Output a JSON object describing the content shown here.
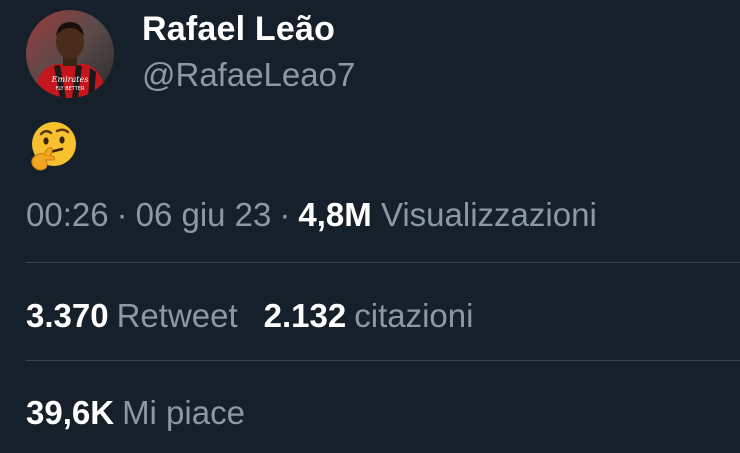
{
  "author": {
    "display_name": "Rafael Leão",
    "handle": "@RafaeLeao7",
    "avatar_icon": "profile-photo",
    "avatar_jersey_text_1": "Emirates",
    "avatar_jersey_text_2": "FLY BETTER"
  },
  "tweet": {
    "emoji": "thinking-face-emoji"
  },
  "meta": {
    "time": "00:26",
    "separator": "·",
    "date": "06 giu 23",
    "views_count": "4,8M",
    "views_label": "Visualizzazioni"
  },
  "stats": {
    "retweets_count": "3.370",
    "retweets_label": "Retweet",
    "quotes_count": "2.132",
    "quotes_label": "citazioni",
    "likes_count": "39,6K",
    "likes_label": "Mi piace"
  },
  "colors": {
    "background": "#15202b",
    "primary_text": "#ffffff",
    "secondary_text": "#8b98a5",
    "divider": "#38444d"
  }
}
